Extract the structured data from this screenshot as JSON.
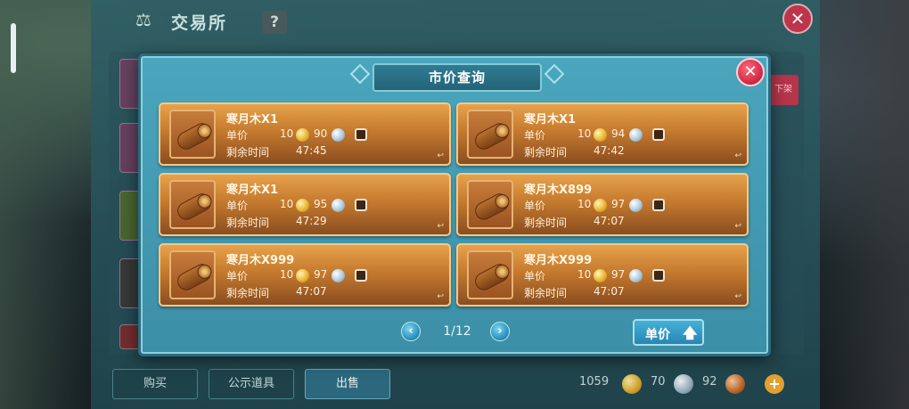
{
  "exchange": {
    "title": "交易所",
    "help_label": "?",
    "close_label": "✕",
    "offsale_label": "下架",
    "tabs": [
      {
        "label": "购买"
      },
      {
        "label": "公示道具"
      },
      {
        "label": "出售"
      }
    ],
    "currencies": [
      {
        "value": "1059",
        "type": "gold"
      },
      {
        "value": "70",
        "type": "silver"
      },
      {
        "value": "92",
        "type": "copper"
      }
    ],
    "plus_label": "+"
  },
  "modal": {
    "title": "市价查询",
    "close_label": "✕",
    "price_label": "单价",
    "time_label": "剩余时间",
    "items": [
      {
        "name": "寒月木X1",
        "price_gold": "10",
        "price_silver": "90",
        "time": "47:45"
      },
      {
        "name": "寒月木X1",
        "price_gold": "10",
        "price_silver": "94",
        "time": "47:42"
      },
      {
        "name": "寒月木X1",
        "price_gold": "10",
        "price_silver": "95",
        "time": "47:29"
      },
      {
        "name": "寒月木X899",
        "price_gold": "10",
        "price_silver": "97",
        "time": "47:07"
      },
      {
        "name": "寒月木X999",
        "price_gold": "10",
        "price_silver": "97",
        "time": "47:07"
      },
      {
        "name": "寒月木X999",
        "price_gold": "10",
        "price_silver": "97",
        "time": "47:07"
      }
    ],
    "pager": {
      "text": "1/12",
      "prev": "‹",
      "next": "›"
    },
    "sort_button": {
      "label": "单价",
      "arrow": "🡅"
    }
  },
  "colors": {
    "modal_bg": "#4aa6bd",
    "card_bg": "#c57a2e",
    "close_red": "#d12a44",
    "button_blue": "#2a86b2"
  }
}
